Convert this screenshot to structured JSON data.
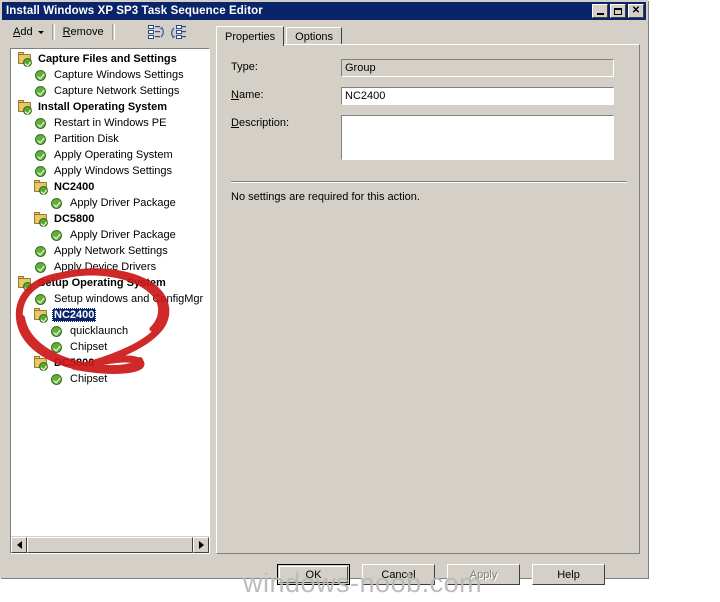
{
  "window": {
    "title": "Install Windows XP SP3 Task Sequence Editor",
    "controls": {
      "minimize": "minimize-button",
      "maximize": "maximize-button",
      "close": "close-button"
    }
  },
  "toolbar": {
    "add_label": "Add",
    "remove_label": "Remove",
    "move_up_icon": "move-up-icon",
    "move_down_icon": "move-down-icon"
  },
  "tree": {
    "nodes": [
      {
        "label": "Capture Files and Settings",
        "level": 1,
        "type": "group",
        "selected": false
      },
      {
        "label": "Capture Windows Settings",
        "level": 2,
        "type": "action",
        "selected": false
      },
      {
        "label": "Capture Network Settings",
        "level": 2,
        "type": "action",
        "selected": false
      },
      {
        "label": "Install Operating System",
        "level": 1,
        "type": "group",
        "selected": false
      },
      {
        "label": "Restart in Windows PE",
        "level": 2,
        "type": "action",
        "selected": false
      },
      {
        "label": "Partition Disk",
        "level": 2,
        "type": "action",
        "selected": false
      },
      {
        "label": "Apply Operating System",
        "level": 2,
        "type": "action",
        "selected": false
      },
      {
        "label": "Apply Windows Settings",
        "level": 2,
        "type": "action",
        "selected": false
      },
      {
        "label": "NC2400",
        "level": 2,
        "type": "group",
        "selected": false
      },
      {
        "label": "Apply Driver Package",
        "level": 3,
        "type": "action",
        "selected": false
      },
      {
        "label": "DC5800",
        "level": 2,
        "type": "group",
        "selected": false
      },
      {
        "label": "Apply Driver Package",
        "level": 3,
        "type": "action",
        "selected": false
      },
      {
        "label": "Apply Network Settings",
        "level": 2,
        "type": "action",
        "selected": false
      },
      {
        "label": "Apply Device Drivers",
        "level": 2,
        "type": "action",
        "selected": false
      },
      {
        "label": "Setup Operating System",
        "level": 1,
        "type": "group",
        "selected": false
      },
      {
        "label": "Setup windows and ConfigMgr",
        "level": 2,
        "type": "action",
        "selected": false
      },
      {
        "label": "NC2400",
        "level": 2,
        "type": "group",
        "selected": true
      },
      {
        "label": "quicklaunch",
        "level": 3,
        "type": "action",
        "selected": false
      },
      {
        "label": "Chipset",
        "level": 3,
        "type": "action",
        "selected": false
      },
      {
        "label": "DC5800",
        "level": 2,
        "type": "group",
        "selected": false
      },
      {
        "label": "Chipset",
        "level": 3,
        "type": "action",
        "selected": false
      }
    ],
    "hscroll": {
      "left_arrow": "scroll-left-arrow",
      "right_arrow": "scroll-right-arrow"
    }
  },
  "tabs": [
    {
      "label": "Properties",
      "active": true
    },
    {
      "label": "Options",
      "active": false
    }
  ],
  "properties": {
    "type_label": "Type:",
    "type_value": "Group",
    "name_label": "Name:",
    "name_accel": "N",
    "name_value": "NC2400",
    "description_label": "Description:",
    "description_accel": "D",
    "description_value": "",
    "note": "No settings are required  for this action."
  },
  "buttons": [
    {
      "label": "OK",
      "default": true,
      "disabled": false,
      "name": "ok-button"
    },
    {
      "label": "Cancel",
      "default": false,
      "disabled": false,
      "name": "cancel-button"
    },
    {
      "label": "Apply",
      "default": false,
      "disabled": true,
      "name": "apply-button"
    },
    {
      "label": "Help",
      "default": false,
      "disabled": false,
      "name": "help-button"
    }
  ],
  "annotation": {
    "ink_color": "#cc1717",
    "shape": "red-circle-highlight"
  },
  "watermark": {
    "text": "windows-noob.com"
  },
  "colors": {
    "titlebar": "#0a246a",
    "window_face": "#d4d0c8",
    "selection": "#0a246a",
    "folder": "#e8c76a",
    "check_green": "#63ae3a"
  }
}
